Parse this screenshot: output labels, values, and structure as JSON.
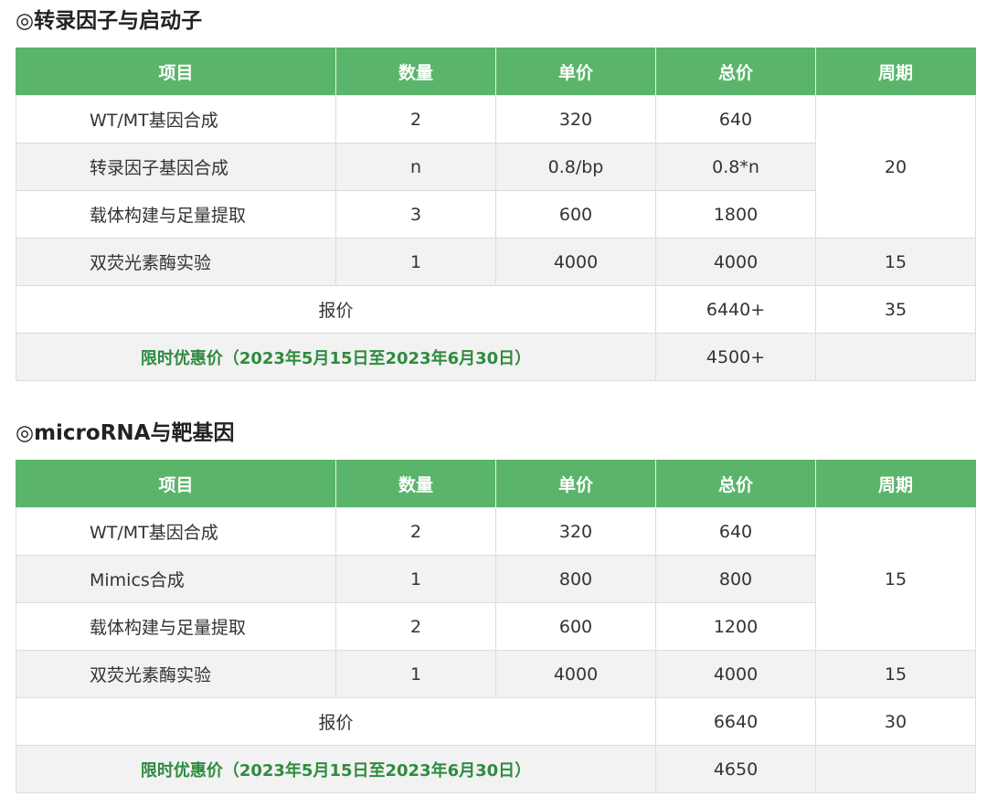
{
  "section1": {
    "title": "◎转录因子与启动子",
    "headers": [
      "项目",
      "数量",
      "单价",
      "总价",
      "周期"
    ],
    "rows": [
      {
        "item": "WT/MT基因合成",
        "qty": "2",
        "unit": "320",
        "total": "640"
      },
      {
        "item": "转录因子基因合成",
        "qty": "n",
        "unit": "0.8/bp",
        "total": "0.8*n"
      },
      {
        "item": "载体构建与足量提取",
        "qty": "3",
        "unit": "600",
        "total": "1800"
      },
      {
        "item": "双荧光素酶实验",
        "qty": "1",
        "unit": "4000",
        "total": "4000"
      }
    ],
    "cycle_group": "20",
    "cycle_last": "15",
    "quote": {
      "label": "报价",
      "total": "6440+",
      "cycle": "35"
    },
    "promo": {
      "label": "限时优惠价（2023年5月15日至2023年6月30日）",
      "total": "4500+",
      "cycle": ""
    }
  },
  "section2": {
    "title": "◎microRNA与靶基因",
    "headers": [
      "项目",
      "数量",
      "单价",
      "总价",
      "周期"
    ],
    "rows": [
      {
        "item": "WT/MT基因合成",
        "qty": "2",
        "unit": "320",
        "total": "640"
      },
      {
        "item": "Mimics合成",
        "qty": "1",
        "unit": "800",
        "total": "800"
      },
      {
        "item": "载体构建与足量提取",
        "qty": "2",
        "unit": "600",
        "total": "1200"
      },
      {
        "item": "双荧光素酶实验",
        "qty": "1",
        "unit": "4000",
        "total": "4000"
      }
    ],
    "cycle_group": "15",
    "cycle_last": "15",
    "quote": {
      "label": "报价",
      "total": "6640",
      "cycle": "30"
    },
    "promo": {
      "label": "限时优惠价（2023年5月15日至2023年6月30日）",
      "total": "4650",
      "cycle": ""
    }
  },
  "colors": {
    "header_bg": "#5ab56b",
    "promo_text": "#2e8b3e",
    "row_shade": "#f2f2f2"
  }
}
